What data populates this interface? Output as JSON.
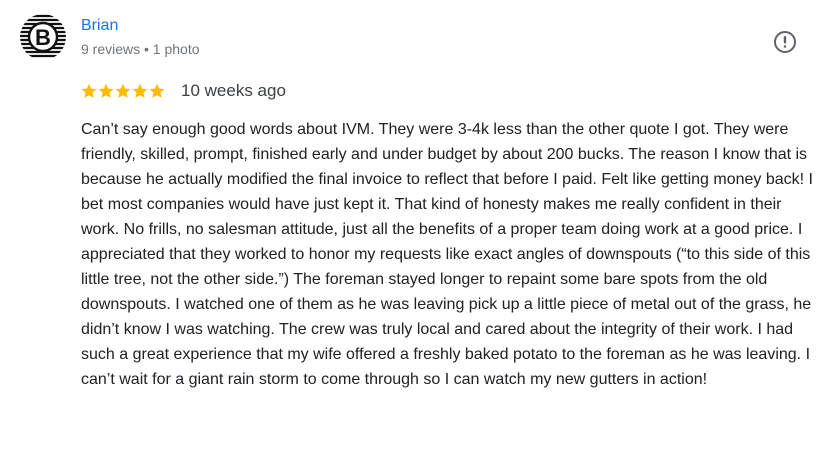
{
  "reviewer": {
    "avatar_letter": "B",
    "avatar_icon": "profile-avatar-striped-circle",
    "name": "Brian",
    "meta": "9 reviews • 1 photo"
  },
  "actions": {
    "more_icon": "exclamation-circle-icon"
  },
  "review": {
    "rating": 5,
    "rating_max": 5,
    "star_color": "#fbbc04",
    "date": "10 weeks ago",
    "text": "Can’t say enough good words about IVM. They were 3-4k less than the other quote I got. They were friendly, skilled, prompt, finished early and under budget by about 200 bucks. The reason I know that is because he actually modified the final invoice to reflect that before I paid. Felt like getting money back! I bet most companies would have just kept it. That kind of honesty makes me really confident in their work. No frills, no salesman attitude, just all the benefits of a proper team doing work at a good price. I appreciated that they worked to honor my requests like exact angles of downspouts (“to this side of this little tree, not the other side.”) The foreman stayed longer to repaint some bare spots from the old downspouts. I watched one of them as he was leaving pick up a little piece of metal out of the grass, he didn’t know I was watching. The crew was truly local and cared about the integrity of their work. I had such a great experience that my wife offered a freshly baked potato to the foreman as he was leaving. I can’t wait for a giant rain storm to come through so I can watch my new gutters in action!"
  },
  "colors": {
    "name_link": "#1a73e8",
    "meta_text": "#70757a",
    "body_text": "#202124"
  }
}
